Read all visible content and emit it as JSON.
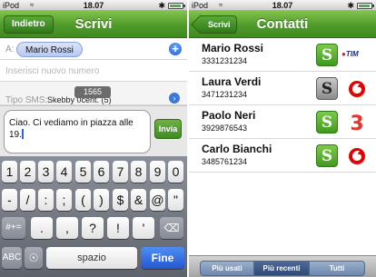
{
  "status": {
    "carrier": "iPod",
    "time": "18.07"
  },
  "compose": {
    "nav_title": "Scrivi",
    "back_label": "Indietro",
    "to_label": "A:",
    "recipient": "Mario Rossi",
    "number_placeholder": "Inserisci nuovo numero",
    "sms_type_label": "Tipo SMS:",
    "sms_type_value": "Skebby 0cent. (5)",
    "char_counter": "1565",
    "message": "Ciao. Ci vediamo in piazza alle 19.",
    "send_label": "Invia"
  },
  "keyboard": {
    "row1": [
      "1",
      "2",
      "3",
      "4",
      "5",
      "6",
      "7",
      "8",
      "9",
      "0"
    ],
    "row2": [
      "-",
      "/",
      ":",
      ";",
      "(",
      ")",
      "$",
      "&",
      "@",
      "\""
    ],
    "switch_label": "#+=",
    "row3": [
      ".",
      ",",
      "?",
      "!",
      "'"
    ],
    "abc_label": "ABC",
    "space_label": "spazio",
    "go_label": "Fine"
  },
  "contacts": {
    "nav_title": "Contatti",
    "back_label": "Scrivi",
    "items": [
      {
        "name": "Mario Rossi",
        "number": "3331231234",
        "badge": "S",
        "badge_style": "green",
        "operator": "TIM"
      },
      {
        "name": "Laura Verdi",
        "number": "3471231234",
        "badge": "S",
        "badge_style": "gray",
        "operator": "vodafone"
      },
      {
        "name": "Paolo Neri",
        "number": "3929876543",
        "badge": "S",
        "badge_style": "green",
        "operator": "3"
      },
      {
        "name": "Carlo Bianchi",
        "number": "3485761234",
        "badge": "S",
        "badge_style": "green",
        "operator": "vodafone"
      }
    ],
    "tabs": [
      "Più usati",
      "Più recenti",
      "Tutti"
    ],
    "active_tab": "Più recenti"
  },
  "colors": {
    "nav_green": "#4f9a2a",
    "badge_green": "#3f9a1f",
    "vodafone_red": "#e60000",
    "tab_blue": "#6d87ad",
    "go_blue": "#2357d1"
  },
  "icons": [
    "wifi-icon",
    "bluetooth-icon",
    "battery-icon",
    "add-contact-icon",
    "skebby-s-icon",
    "vodafone-icon",
    "tre-icon",
    "tim-logo"
  ]
}
